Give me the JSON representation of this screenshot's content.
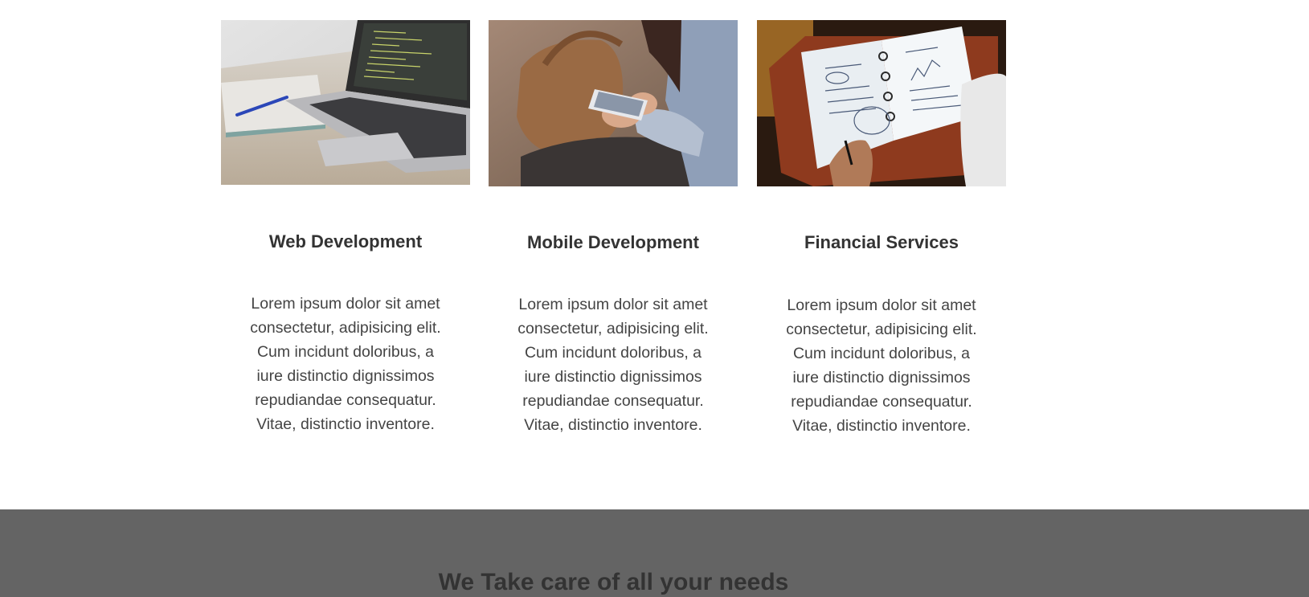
{
  "services": [
    {
      "image_alt": "Laptop with code on a desk next to a notebook and pen",
      "title": "Web Development",
      "text": "Lorem ipsum dolor sit amet consectetur, adipisicing elit. Cum incidunt doloribus, a iure distinctio dignissimos repudiandae consequatur. Vitae, distinctio inventore."
    },
    {
      "image_alt": "Person sitting with a bag holding a smartphone",
      "title": "Mobile Development",
      "text": "Lorem ipsum dolor sit amet consectetur, adipisicing elit. Cum incidunt doloribus, a iure distinctio dignissimos repudiandae consequatur. Vitae, distinctio inventore."
    },
    {
      "image_alt": "Hand writing financial notes and charts in a planner",
      "title": "Financial Services",
      "text": "Lorem ipsum dolor sit amet consectetur, adipisicing elit. Cum incidunt doloribus, a iure distinctio dignissimos repudiandae consequatur. Vitae, distinctio inventore."
    }
  ],
  "banner": {
    "title": "We Take care of all your needs"
  },
  "colors": {
    "page_background": "#ffffff",
    "banner_background": "#646464",
    "heading_text": "#333333",
    "body_text": "#444444"
  }
}
